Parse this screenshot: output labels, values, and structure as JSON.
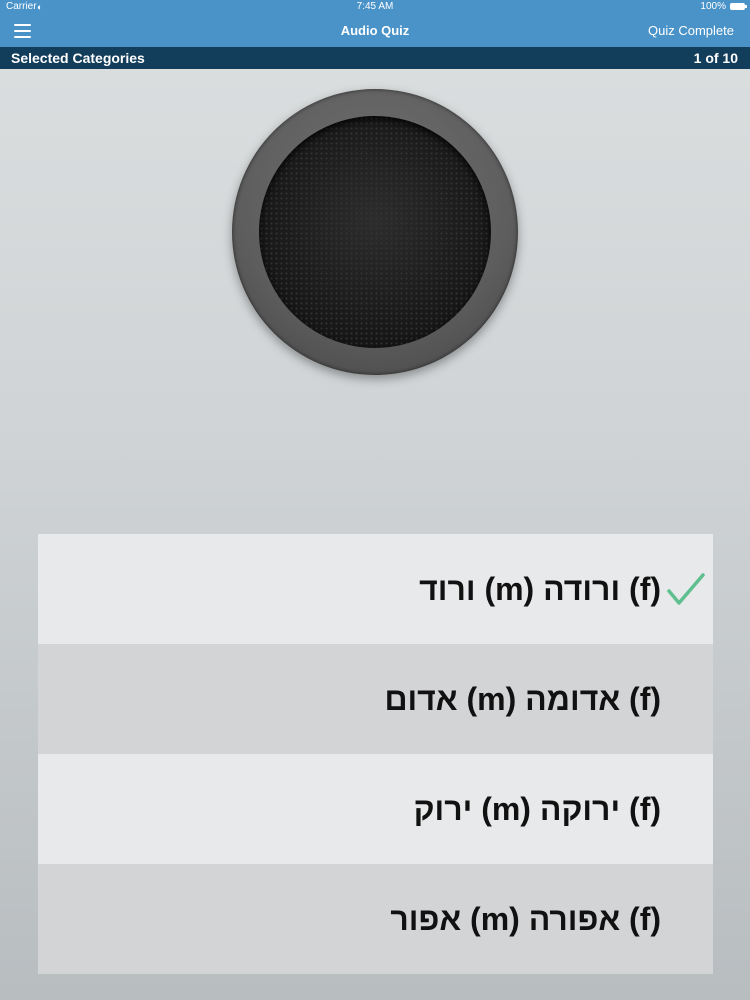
{
  "status_bar": {
    "carrier": "Carrier",
    "time": "7:45 AM",
    "battery": "100%"
  },
  "nav": {
    "title": "Audio Quiz",
    "right_button": "Quiz Complete",
    "menu_icon": "hamburger-icon"
  },
  "sub_bar": {
    "left": "Selected Categories",
    "right": "1 of 10"
  },
  "speaker": {
    "icon": "speaker-grille-icon"
  },
  "answers": [
    {
      "text": "ורוד (m)  ורודה (f)",
      "correct": true
    },
    {
      "text": "אדום (m)  אדומה (f)",
      "correct": false
    },
    {
      "text": "ירוק (m)  ירוקה (f)",
      "correct": false
    },
    {
      "text": "אפור (m)  אפורה (f)",
      "correct": false
    }
  ],
  "colors": {
    "nav_blue": "#4a93c9",
    "sub_bar_navy": "#123e5c",
    "check_green": "#5fbf8f"
  }
}
